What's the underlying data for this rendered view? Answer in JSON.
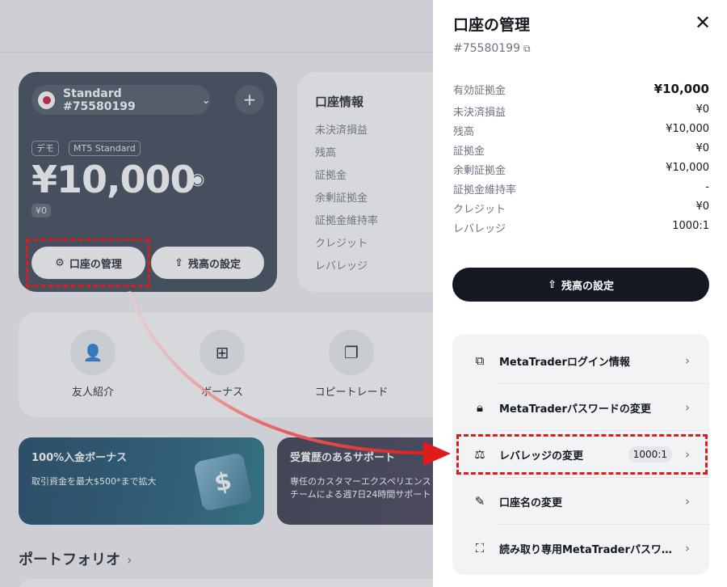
{
  "background": {
    "account_selector": {
      "label": "Standard #75580199"
    },
    "tags": [
      "デモ",
      "MT5 Standard"
    ],
    "balance": "¥10,000",
    "pnl": "¥0",
    "buttons": {
      "manage": "口座の管理",
      "set_balance": "残高の設定"
    },
    "info_card": {
      "title": "口座情報",
      "rows": [
        "未決済損益",
        "残高",
        "証拠金",
        "余剰証拠金",
        "証拠金維持率",
        "クレジット",
        "レバレッジ"
      ]
    },
    "quick_actions": [
      {
        "label": "友人紹介",
        "icon": "add-user-icon"
      },
      {
        "label": "ボーナス",
        "icon": "gift-icon"
      },
      {
        "label": "コピートレード",
        "icon": "copy-icon"
      }
    ],
    "promos": [
      {
        "title": "100%入金ボーナス",
        "body": "取引資金を最大$500*まで拡大"
      },
      {
        "title": "受賞歴のあるサポート",
        "body": "専任のカスタマーエクスペリエンス\nチームによる週7日24時間サポート"
      }
    ],
    "portfolio_title": "ポートフォリオ"
  },
  "panel": {
    "title": "口座の管理",
    "account_id": "#75580199",
    "stats": [
      {
        "label": "有効証拠金",
        "value": "¥10,000"
      },
      {
        "label": "未決済損益",
        "value": "¥0"
      },
      {
        "label": "残高",
        "value": "¥10,000"
      },
      {
        "label": "証拠金",
        "value": "¥0"
      },
      {
        "label": "余剰証拠金",
        "value": "¥10,000"
      },
      {
        "label": "証拠金維持率",
        "value": "-"
      },
      {
        "label": "クレジット",
        "value": "¥0"
      },
      {
        "label": "レバレッジ",
        "value": "1000:1"
      }
    ],
    "set_balance_button": "残高の設定",
    "menu": [
      {
        "label": "MetaTraderログイン情報",
        "icon": "chart-icon"
      },
      {
        "label": "MetaTraderパスワードの変更",
        "icon": "lock-icon"
      },
      {
        "label": "レバレッジの変更",
        "icon": "leverage-icon",
        "badge": "1000:1"
      },
      {
        "label": "口座名の変更",
        "icon": "edit-user-icon"
      },
      {
        "label": "読み取り専用MetaTraderパスワ…",
        "icon": "scan-icon"
      }
    ]
  },
  "colors": {
    "accent_red": "#e01b1b",
    "dark": "#141821",
    "card_dark": "#323b4b"
  }
}
